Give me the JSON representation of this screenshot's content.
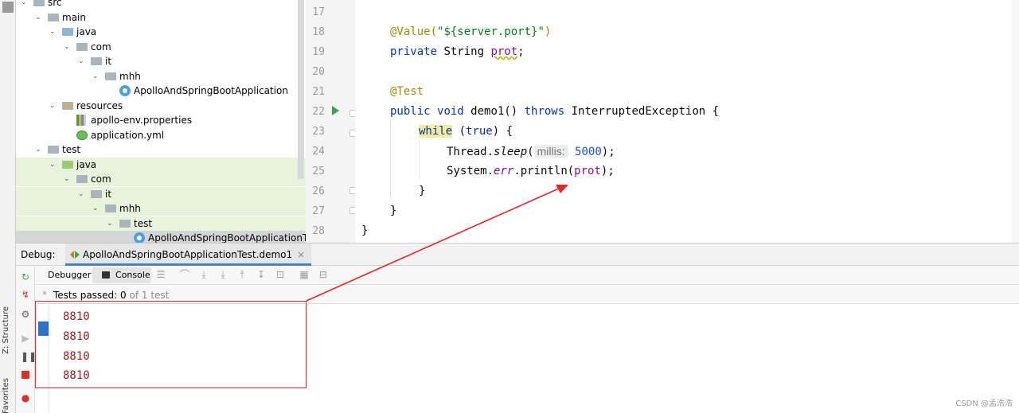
{
  "project_tree": {
    "items": [
      {
        "label": "src",
        "level": 2,
        "kind": "folder-gray",
        "expanded": true
      },
      {
        "label": "main",
        "level": 3,
        "kind": "folder-gray",
        "expanded": true
      },
      {
        "label": "java",
        "level": 4,
        "kind": "folder-blue",
        "expanded": true
      },
      {
        "label": "com",
        "level": 5,
        "kind": "package",
        "expanded": true
      },
      {
        "label": "it",
        "level": 6,
        "kind": "package",
        "expanded": true
      },
      {
        "label": "mhh",
        "level": 7,
        "kind": "package",
        "expanded": true
      },
      {
        "label": "ApolloAndSpringBootApplication",
        "level": 8,
        "kind": "class"
      },
      {
        "label": "resources",
        "level": 4,
        "kind": "folder-res",
        "expanded": true
      },
      {
        "label": "apollo-env.properties",
        "level": 5,
        "kind": "properties"
      },
      {
        "label": "application.yml",
        "level": 5,
        "kind": "yml"
      },
      {
        "label": "test",
        "level": 3,
        "kind": "folder-gray",
        "expanded": true
      },
      {
        "label": "java",
        "level": 4,
        "kind": "folder-green",
        "expanded": true
      },
      {
        "label": "com",
        "level": 5,
        "kind": "package",
        "expanded": true
      },
      {
        "label": "it",
        "level": 6,
        "kind": "package",
        "expanded": true
      },
      {
        "label": "mhh",
        "level": 7,
        "kind": "package",
        "expanded": true
      },
      {
        "label": "test",
        "level": 8,
        "kind": "package",
        "expanded": true
      },
      {
        "label": "ApolloAndSpringBootApplicationTe",
        "level": 9,
        "kind": "class"
      }
    ]
  },
  "editor": {
    "line_numbers": [
      "17",
      "18",
      "19",
      "20",
      "21",
      "22",
      "23",
      "24",
      "25",
      "26",
      "27",
      "28"
    ],
    "lines": {
      "l18_ann": "@Value(",
      "l18_str": "\"${server.port}\"",
      "l18_end": ")",
      "l19_kw": "private",
      "l19_mid": " String ",
      "l19_fld": "prot",
      "l19_end": ";",
      "l21_ann": "@Test",
      "l22_kw1": "public",
      "l22_sp": " ",
      "l22_kw2": "void",
      "l22_mid": " demo1() ",
      "l22_kw3": "throws",
      "l22_end": " InterruptedException {",
      "l23_kw": "while",
      "l23_sp": " (",
      "l23_kw2": "true",
      "l23_end": ") {",
      "l24_a": "Thread.",
      "l24_method": "sleep",
      "l24_b": "(",
      "l24_hint": "millis:",
      "l24_num": "5000",
      "l24_end": ");",
      "l25_a": "System.",
      "l25_err": "err",
      "l25_b": ".println(",
      "l25_fld": "prot",
      "l25_end": ");",
      "l26": "}",
      "l27": "}",
      "l28": "}"
    }
  },
  "debug": {
    "label": "Debug:",
    "run_tab": "ApolloAndSpringBootApplicationTest.demo1",
    "close_glyph": "×",
    "tab_debugger": "Debugger",
    "tab_console": "Console",
    "tests_label": "Tests passed: ",
    "tests_passed": "0",
    "tests_of": " of 1 test",
    "output": [
      "8810",
      "8810",
      "8810",
      "8810"
    ]
  },
  "side_labels": {
    "structure": "Z: Structure",
    "favorites": "Favorites"
  },
  "watermark": "CSDN @孟浩浩",
  "colors": {
    "annotation_red": "#e0262b",
    "console_output": "#9b1b1b",
    "keyword": "#0033b3",
    "string": "#067d17"
  }
}
